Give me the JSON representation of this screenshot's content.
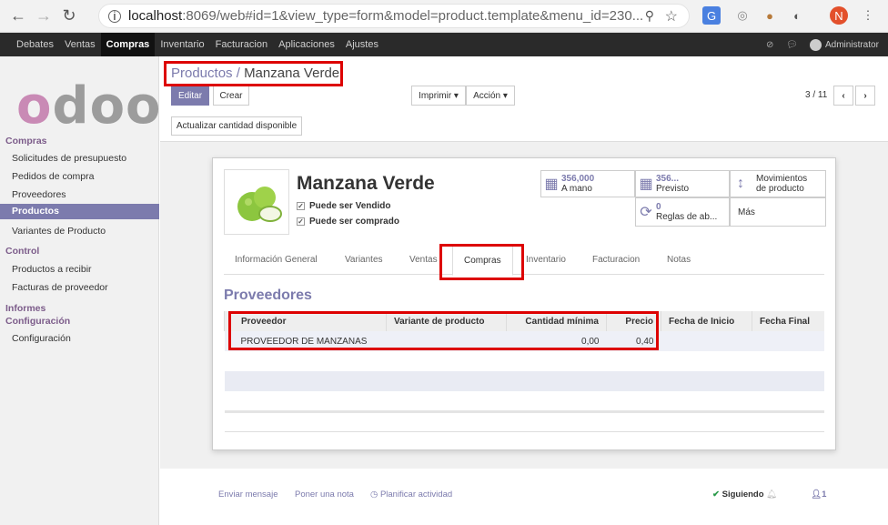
{
  "browser": {
    "url_host": "localhost",
    "url_rest": ":8069/web#id=1&view_type=form&model=product.template&menu_id=230..."
  },
  "topbar": {
    "items": [
      "Debates",
      "Ventas",
      "Compras",
      "Inventario",
      "Facturacion",
      "Aplicaciones",
      "Ajustes"
    ],
    "user": "Administrator"
  },
  "sidebar": {
    "section1": "Compras",
    "items1": [
      "Solicitudes de presupuesto",
      "Pedidos de compra",
      "Proveedores",
      "Productos",
      "Variantes de Producto"
    ],
    "section2": "Control",
    "items2": [
      "Productos a recibir",
      "Facturas de proveedor"
    ],
    "section3": "Informes",
    "section4": "Configuración",
    "items4": [
      "Configuración"
    ]
  },
  "breadcrumb": {
    "parent": "Productos",
    "sep": "/",
    "current": "Manzana Verde"
  },
  "buttons": {
    "edit": "Editar",
    "create": "Crear",
    "print": "Imprimir ▾",
    "action": "Acción ▾",
    "update_qty": "Actualizar cantidad disponible"
  },
  "pager": {
    "text": "3 / 11"
  },
  "product": {
    "name": "Manzana Verde",
    "can_sell": "Puede ser Vendido",
    "can_buy": "Puede ser comprado"
  },
  "stats": {
    "on_hand_value": "356,000",
    "on_hand_label": "A mano",
    "forecast_value": "356...",
    "forecast_label": "Previsto",
    "moves_label1": "Movimientos",
    "moves_label2": "de producto",
    "rules_value": "0",
    "rules_label": "Reglas de ab...",
    "more": "Más"
  },
  "tabs": [
    "Información General",
    "Variantes",
    "Ventas",
    "Compras",
    "Inventario",
    "Facturacion",
    "Notas"
  ],
  "section_title": "Proveedores",
  "table": {
    "headers": [
      "Proveedor",
      "Variante de producto",
      "Cantidad mínima",
      "Precio",
      "Fecha de Inicio",
      "Fecha Final"
    ],
    "rows": [
      [
        "PROVEEDOR DE MANZANAS",
        "",
        "0,00",
        "0,40",
        "",
        ""
      ]
    ]
  },
  "chatter": {
    "send": "Enviar mensaje",
    "note": "Poner una nota",
    "activity": "Planificar actividad",
    "following": "Siguiendo",
    "followers": "1"
  }
}
